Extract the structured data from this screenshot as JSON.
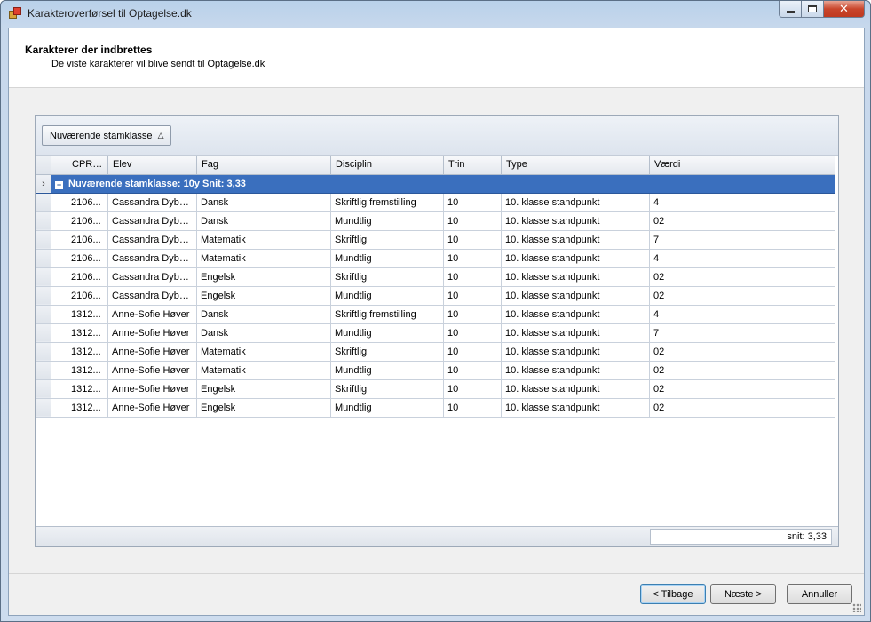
{
  "window": {
    "title": "Karakteroverførsel til Optagelse.dk",
    "close_glyph": "✕"
  },
  "header": {
    "title": "Karakterer der indbrettes",
    "subtitle": "De viste karakterer vil blive sendt til Optagelse.dk"
  },
  "grid": {
    "group_chip": {
      "label": "Nuværende stamklasse",
      "sort_glyph": "△"
    },
    "columns": [
      "CPR n...",
      "Elev",
      "Fag",
      "Disciplin",
      "Trin",
      "Type",
      "Værdi"
    ],
    "group_row": {
      "indicator": "›",
      "expander": "−",
      "label": "Nuværende stamklasse: 10y Snit: 3,33"
    },
    "rows": [
      [
        "2106...",
        "Cassandra Dybd...",
        "Dansk",
        "Skriftlig fremstilling",
        "10",
        "10. klasse standpunkt",
        "4"
      ],
      [
        "2106...",
        "Cassandra Dybd...",
        "Dansk",
        "Mundtlig",
        "10",
        "10. klasse standpunkt",
        "02"
      ],
      [
        "2106...",
        "Cassandra Dybd...",
        "Matematik",
        "Skriftlig",
        "10",
        "10. klasse standpunkt",
        "7"
      ],
      [
        "2106...",
        "Cassandra Dybd...",
        "Matematik",
        "Mundtlig",
        "10",
        "10. klasse standpunkt",
        "4"
      ],
      [
        "2106...",
        "Cassandra Dybd...",
        "Engelsk",
        "Skriftlig",
        "10",
        "10. klasse standpunkt",
        "02"
      ],
      [
        "2106...",
        "Cassandra Dybd...",
        "Engelsk",
        "Mundtlig",
        "10",
        "10. klasse standpunkt",
        "02"
      ],
      [
        "1312...",
        "Anne-Sofie Høver",
        "Dansk",
        "Skriftlig fremstilling",
        "10",
        "10. klasse standpunkt",
        "4"
      ],
      [
        "1312...",
        "Anne-Sofie Høver",
        "Dansk",
        "Mundtlig",
        "10",
        "10. klasse standpunkt",
        "7"
      ],
      [
        "1312...",
        "Anne-Sofie Høver",
        "Matematik",
        "Skriftlig",
        "10",
        "10. klasse standpunkt",
        "02"
      ],
      [
        "1312...",
        "Anne-Sofie Høver",
        "Matematik",
        "Mundtlig",
        "10",
        "10. klasse standpunkt",
        "02"
      ],
      [
        "1312...",
        "Anne-Sofie Høver",
        "Engelsk",
        "Skriftlig",
        "10",
        "10. klasse standpunkt",
        "02"
      ],
      [
        "1312...",
        "Anne-Sofie Høver",
        "Engelsk",
        "Mundtlig",
        "10",
        "10. klasse standpunkt",
        "02"
      ]
    ],
    "footer_summary": "snit: 3,33"
  },
  "buttons": {
    "back": "< Tilbage",
    "next": "Næste >",
    "cancel": "Annuller"
  },
  "colors": {
    "group_row_bg": "#3a6fbe",
    "title_bar": "#b9d1ea",
    "close_button": "#c9462c"
  }
}
